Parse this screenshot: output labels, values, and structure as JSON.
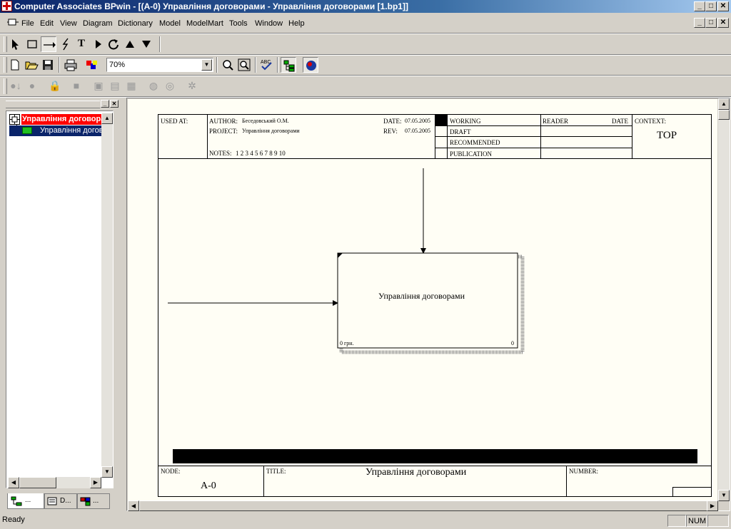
{
  "window": {
    "title": "Computer Associates BPwin - [(A-0) Управління договорами - Управління договорами  [1.bp1]]",
    "min_glyph": "_",
    "max_glyph": "□",
    "close_glyph": "✕"
  },
  "menu": {
    "items": [
      "File",
      "Edit",
      "View",
      "Diagram",
      "Dictionary",
      "Model",
      "ModelMart",
      "Tools",
      "Window",
      "Help"
    ]
  },
  "toolbar": {
    "zoom_value": "70%"
  },
  "explorer": {
    "root_label": "Управління договорами",
    "child_label": "Управління договорами",
    "tabs": [
      "...",
      "D...",
      "..."
    ],
    "root_color": "#ff0000",
    "child_color": "#0a246a"
  },
  "diagram": {
    "used_at_label": "USED AT:",
    "author_label": "AUTHOR:",
    "author_value": "Беседовський О.М.",
    "project_label": "PROJECT:",
    "project_value": "Управління договорами",
    "date_label": "DATE:",
    "date_value": "07.05.2005",
    "rev_label": "REV:",
    "rev_value": "07.05.2005",
    "notes_label": "NOTES:",
    "notes_value": "1  2  3  4  5  6  7  8  9  10",
    "status": [
      "WORKING",
      "DRAFT",
      "RECOMMENDED",
      "PUBLICATION"
    ],
    "reader_label": "READER",
    "reader_date_label": "DATE",
    "context_label": "CONTEXT:",
    "context_value": "TOP",
    "box_label": "Управління договорами",
    "box_cost": "0 грн.",
    "box_number": "0",
    "node_label": "NODE:",
    "node_value": "A-0",
    "title_label": "TITLE:",
    "title_value": "Управління договорами",
    "number_label": "NUMBER:"
  },
  "status": {
    "text": "Ready",
    "num": "NUM"
  }
}
